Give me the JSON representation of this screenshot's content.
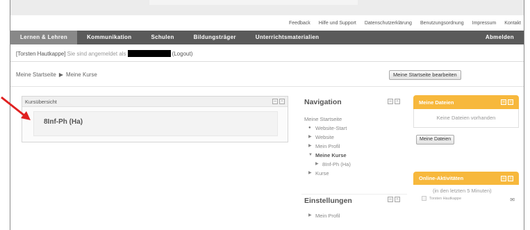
{
  "utility_nav": [
    "Feedback",
    "Hilfe und Support",
    "Datenschutzerklärung",
    "Benutzungsordnung",
    "Impressum",
    "Kontakt"
  ],
  "main_nav": {
    "items": [
      "Lernen & Lehren",
      "Kommunikation",
      "Schulen",
      "Bildungsträger",
      "Unterrichtsmaterialien"
    ],
    "logout": "Abmelden"
  },
  "login": {
    "user": "[Torsten Hautkappe]",
    "text": "Sie sind angemeldet als",
    "logout": "(Logout)"
  },
  "breadcrumb": {
    "home": "Meine Startseite",
    "separator": "▶",
    "current": "Meine Kurse"
  },
  "edit_button": "Meine Startseite bearbeiten",
  "course_overview": {
    "title": "Kursübersicht",
    "course": "8Inf-Ph (Ha)"
  },
  "navigation": {
    "title": "Navigation",
    "home": "Meine Startseite",
    "items": [
      "Website-Start",
      "Website",
      "Mein Profil",
      "Meine Kurse",
      "8Inf-Ph (Ha)",
      "Kurse"
    ]
  },
  "settings": {
    "title": "Einstellungen",
    "item": "Mein Profil"
  },
  "my_files": {
    "title": "Meine Dateien",
    "empty": "Keine Dateien vorhanden",
    "button": "Meine Dateien"
  },
  "online": {
    "title": "Online-Aktivitäten",
    "info": "(in den letzten 5 Minuten)",
    "user": "Torsten Hautkappe"
  },
  "colors": {
    "nav_bg": "#5a5a5a",
    "accent_orange": "#f7b83c",
    "arrow_red": "#e02020"
  }
}
